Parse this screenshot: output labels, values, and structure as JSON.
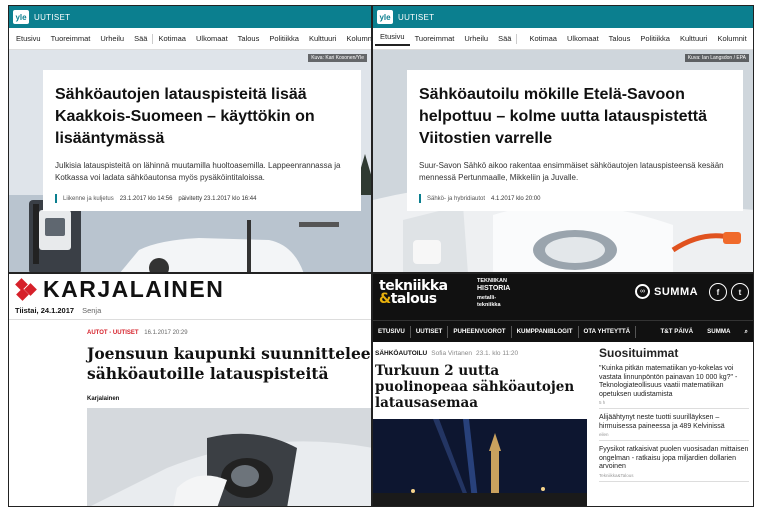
{
  "yle": {
    "brand": "UUTISET",
    "logo": "yle",
    "nav": [
      "Etusivu",
      "Tuoreimmat",
      "Urheilu",
      "Sää",
      "Kotimaa",
      "Ulkomaat",
      "Talous",
      "Politiikka",
      "Kulttuuri",
      "Kolumnit"
    ],
    "article1": {
      "title": "Sähköautojen latauspisteitä lisää Kaakkois-Suomeen – käyttökin on lisääntymässä",
      "lead": "Julkisia latauspisteitä on lähinnä muutamilla huoltoasemilla. Lappeenrannassa ja Kotkassa voi ladata sähköautonsa myös pysäköintitaloissa.",
      "category": "Liikenne ja kuljetus",
      "date": "23.1.2017 klo 14:56",
      "updated": "päivitetty 23.1.2017 klo 16:44",
      "credit": "Kuva: Kari Kosonen/Yle"
    },
    "article2": {
      "title": "Sähköautoilu mökille Etelä-Savoon helpottuu – kolme uutta latauspistettä Viitostien varrelle",
      "lead": "Suur-Savon Sähkö aikoo rakentaa ensimmäiset sähköautojen latauspisteensä kesään mennessä Pertunmaalle, Mikkeliin ja Juvalle.",
      "category": "Sähkö- ja hybridiautot",
      "date": "4.1.2017 klo 20:00",
      "credit": "Kuva: Ian Langsdon / EPA"
    }
  },
  "karjalainen": {
    "logo": "KARJALAINEN",
    "date": "Tiistai, 24.1.2017",
    "nameday": "Senja",
    "kicker": "AUTOT - UUTISET",
    "time": "16.1.2017 20:29",
    "title": "Joensuun kaupunki suunnittelee sähköautoille latauspisteitä",
    "author": "Karjalainen"
  },
  "tt": {
    "logo_line1": "tekniikka",
    "logo_amp": "&",
    "logo_line2": "talous",
    "side1": "TEKNIIKAN",
    "side2": "HISTORIA",
    "side3": "metalli-",
    "side4": "tekniikka",
    "summa": "SUMMA",
    "nav": [
      "ETUSIVU",
      "UUTISET",
      "PUHEENVUOROT",
      "KUMPPANIBLOGIT",
      "OTA YHTEYTTÄ"
    ],
    "nav_right": "T&T PÄIVÄ",
    "nav_summa": "SUMMA",
    "kicker": "SÄHKÖAUTOILU",
    "author": "Sofia Virtanen",
    "date": "23.1. klo 11:20",
    "title": "Turkuun 2 uutta puolinopeaa sähköautojen latausasemaa",
    "popular_heading": "Suosituimmat",
    "popular": [
      {
        "title": "\"Kuinka pitkän matematiikan yo-kokelas voi vastata linnunpöntön painavan 10 000 kg?\" - Teknologiateollisuus vaatii matematiikan opetuksen uudistamista",
        "meta": "5 h"
      },
      {
        "title": "Alijäähtynyt neste tuotti suurilläyksen – hirmuisessa paineessa ja 489 Kelvinissä",
        "meta": "eilen"
      },
      {
        "title": "Fyysikot ratkaisivat puolen vuosisadan mittaisen ongelman - ratkaisu jopa miljardien dollarien arvoinen",
        "meta": "Tekniikka&Talous"
      }
    ]
  }
}
